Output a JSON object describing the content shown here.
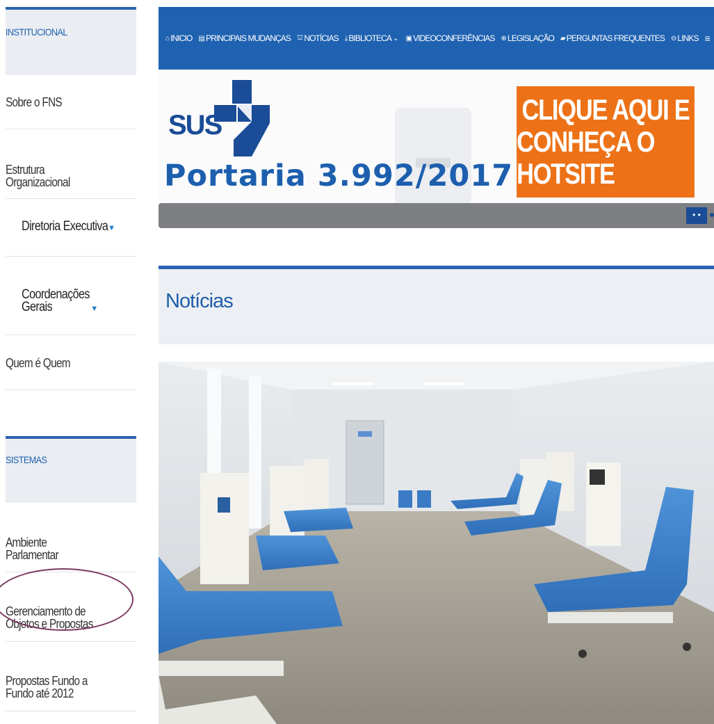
{
  "sidebar": {
    "institucional_header": "INSTITUCIONAL",
    "institucional_items": [
      {
        "label": "Sobre o FNS"
      },
      {
        "label": "Estrutura\nOrganizacional"
      },
      {
        "label": "Diretoria Executiva"
      },
      {
        "label": "Coordenações\nGerais"
      },
      {
        "label": "Quem é Quem"
      }
    ],
    "sistemas_header": "SISTEMAS",
    "sistemas_items": [
      {
        "label": "Ambiente\nParlamentar"
      },
      {
        "label": "Gerenciamento de\nObjetos e Propostas"
      },
      {
        "label": "Propostas Fundo a\nFundo até 2012"
      }
    ]
  },
  "nav": {
    "items": [
      {
        "icon": "home-icon",
        "label": "INICIO"
      },
      {
        "icon": "list-icon",
        "label": "PRINCIPAIS MUDANÇAS"
      },
      {
        "icon": "bank-icon",
        "label": "NOTÍCIAS"
      },
      {
        "icon": "download-icon",
        "label": "BIBLIOTECA"
      },
      {
        "icon": "video-icon",
        "label": "VIDEOCONFERÊNCIAS"
      },
      {
        "icon": "plus-circle-icon",
        "label": "LEGISLAÇÃO"
      },
      {
        "icon": "book-icon",
        "label": "PERGUNTAS FREQUENTES"
      },
      {
        "icon": "link-icon",
        "label": "LINKS"
      }
    ]
  },
  "banner": {
    "sus": "SUS",
    "portaria": "Portaria 3.992/2017",
    "cta_line1": "CLIQUE AQUI E",
    "cta_line2": "CONHEÇA O HOTSITE",
    "dots": "• •"
  },
  "noticias": {
    "title": "Notícias"
  },
  "colors": {
    "nav_blue": "#1f62b1",
    "cta_orange": "#ed7116",
    "accent_blue": "#2c63b0",
    "panel_bg": "#ecf0f4",
    "oval": "#7a3a63"
  }
}
